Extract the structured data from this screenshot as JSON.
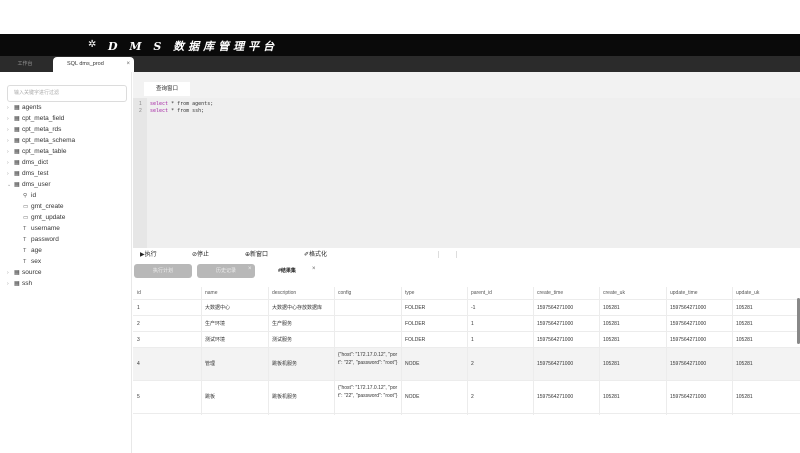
{
  "app": {
    "title": "D M S 数据库管理平台",
    "logo_icon": "gear-icon"
  },
  "tabs": {
    "workspace": "工作台",
    "active": "SQL dms_prod",
    "close": "×"
  },
  "sidebar": {
    "search_placeholder": "输入关键字进行过滤",
    "tables": [
      {
        "name": "agents",
        "expanded": false
      },
      {
        "name": "cpt_meta_field",
        "expanded": false
      },
      {
        "name": "cpt_meta_rds",
        "expanded": false
      },
      {
        "name": "cpt_meta_schema",
        "expanded": false
      },
      {
        "name": "cpt_meta_table",
        "expanded": false
      },
      {
        "name": "dms_dict",
        "expanded": false
      },
      {
        "name": "dms_test",
        "expanded": false
      },
      {
        "name": "dms_user",
        "expanded": true
      }
    ],
    "columns": [
      {
        "name": "id",
        "icon": "key"
      },
      {
        "name": "gmt_create",
        "icon": "date"
      },
      {
        "name": "gmt_update",
        "icon": "date"
      },
      {
        "name": "username",
        "icon": "text"
      },
      {
        "name": "password",
        "icon": "text"
      },
      {
        "name": "age",
        "icon": "text"
      },
      {
        "name": "sex",
        "icon": "text"
      }
    ],
    "tables_after": [
      {
        "name": "source",
        "expanded": false
      },
      {
        "name": "ssh",
        "expanded": false
      }
    ]
  },
  "editor": {
    "tab": "查询窗口",
    "lines": [
      {
        "no": "1",
        "kw": "select",
        "rest": " * from agents;"
      },
      {
        "no": "2",
        "kw": "select",
        "rest": " * from ssh;"
      }
    ]
  },
  "toolbar": {
    "run": "▶执行",
    "stop": "⊘停止",
    "new_window": "⊕新窗口",
    "format": "✐格式化"
  },
  "result_tabs": {
    "tab1": "执行计划",
    "tab2": "历史记录",
    "tab3": "#结果集",
    "close": "×"
  },
  "grid": {
    "headers": [
      "id",
      "name",
      "description",
      "config",
      "type",
      "parent_id",
      "create_time",
      "create_uk",
      "update_time",
      "update_uk"
    ],
    "rows": [
      [
        "1",
        "大数据中心",
        "大数据中心存放数据库",
        "",
        "FOLDER",
        "-1",
        "1597564271000",
        "105281",
        "1597564271000",
        "105281"
      ],
      [
        "2",
        "生产环境",
        "生产服务",
        "",
        "FOLDER",
        "1",
        "1597564271000",
        "105281",
        "1597564271000",
        "105281"
      ],
      [
        "3",
        "测试环境",
        "测试服务",
        "",
        "FOLDER",
        "1",
        "1597564271000",
        "105281",
        "1597564271000",
        "105281"
      ],
      [
        "4",
        "管理",
        "跳板机服务",
        "{\"host\": \"172.17.0.12\", \"port\": \"22\", \"password\": \"root\"}",
        "NODE",
        "2",
        "1597564271000",
        "105281",
        "1597564271000",
        "105281"
      ],
      [
        "5",
        "跳板",
        "跳板机服务",
        "{\"host\": \"172.17.0.12\", \"port\": \"22\", \"password\": \"root\"}",
        "NODE",
        "2",
        "1597564271000",
        "105281",
        "1597564271000",
        "105281"
      ]
    ]
  }
}
